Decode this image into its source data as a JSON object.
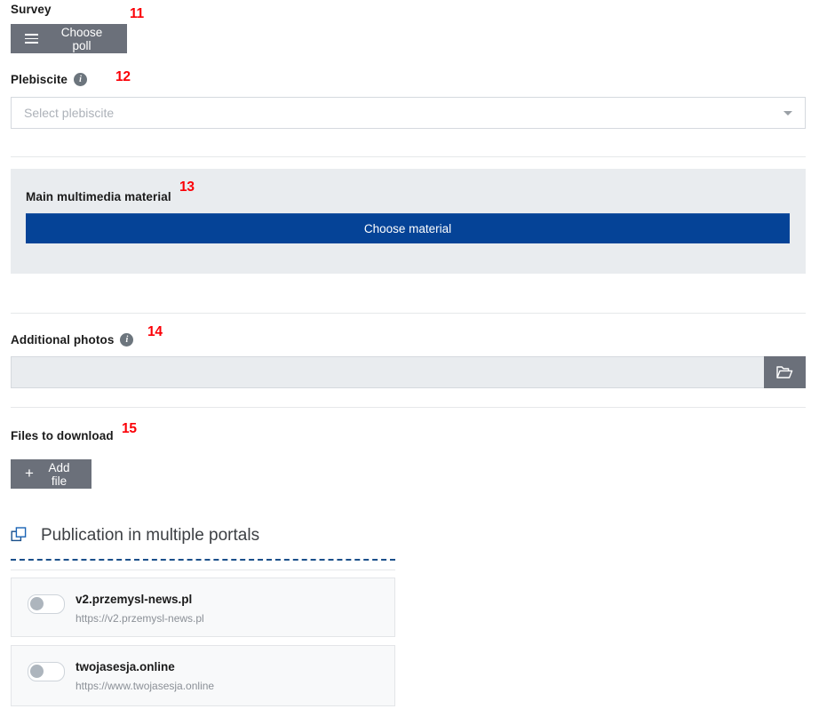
{
  "survey": {
    "label": "Survey",
    "choose_poll_button": "Choose poll",
    "menu_icon": "hamburger-icon",
    "annotation": "11"
  },
  "plebiscite": {
    "label": "Plebiscite",
    "info_icon": "info-icon",
    "info_glyph": "i",
    "select_placeholder": "Select plebiscite",
    "select_value": "",
    "dropdown_icon": "chevron-down-icon",
    "annotation": "12"
  },
  "main_material": {
    "label": "Main multimedia material",
    "choose_button": "Choose material",
    "annotation": "13"
  },
  "additional_photos": {
    "label": "Additional photos",
    "info_icon": "info-icon",
    "info_glyph": "i",
    "input_value": "",
    "browse_icon": "folder-open-icon",
    "annotation": "14"
  },
  "files_to_download": {
    "label": "Files to download",
    "add_file_button": "Add file",
    "plus_glyph": "+",
    "annotation": "15"
  },
  "multi_portal": {
    "title": "Publication in multiple portals",
    "title_icon": "copy-icon",
    "portals": [
      {
        "name": "v2.przemysl-news.pl",
        "url": "https://v2.przemysl-news.pl",
        "enabled": false
      },
      {
        "name": "twojasesja.online",
        "url": "https://www.twojasesja.online",
        "enabled": false
      }
    ]
  },
  "colors": {
    "annotation_red": "#fb0007",
    "button_gray": "#6b707a",
    "button_blue": "#054397",
    "panel_gray": "#e9ecef",
    "dashed_blue": "#1a4f8a"
  }
}
